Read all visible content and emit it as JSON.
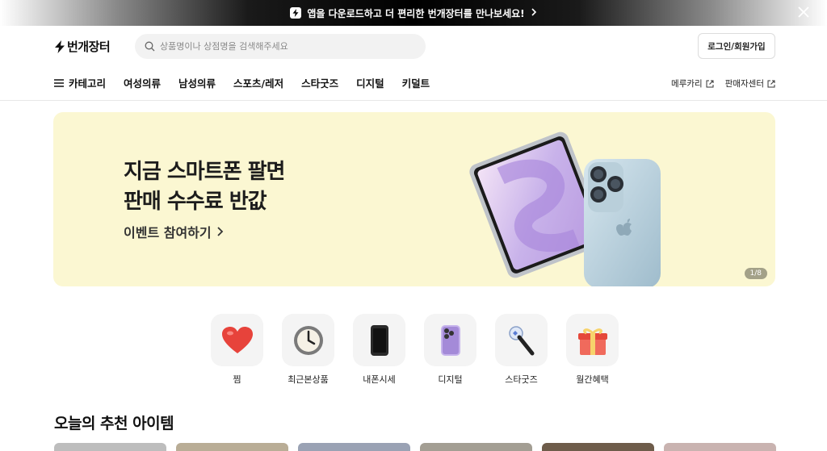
{
  "top_banner": {
    "text": "앱을 다운로드하고 더 편리한 번개장터를 만나보세요!",
    "chevron": "›"
  },
  "header": {
    "logo_text": "번개장터",
    "search_placeholder": "상품명이나 상점명을 검색해주세요",
    "login_label": "로그인/회원가입",
    "nav": [
      "카테고리",
      "여성의류",
      "남성의류",
      "스포츠/레저",
      "스타굿즈",
      "디지털",
      "키덜트"
    ],
    "ext_links": [
      "메루카리",
      "판매자센터"
    ]
  },
  "hero": {
    "title_line1": "지금 스마트폰 팔면",
    "title_line2": "판매 수수료 반값",
    "cta": "이벤트 참여하기",
    "pager": "1/8",
    "bg_color": "#fbf7d2"
  },
  "quick_menu": [
    {
      "label": "찜",
      "icon": "heart-icon"
    },
    {
      "label": "최근본상품",
      "icon": "clock-icon"
    },
    {
      "label": "내폰시세",
      "icon": "phone-icon"
    },
    {
      "label": "디지털",
      "icon": "smartphone-purple-icon"
    },
    {
      "label": "스타굿즈",
      "icon": "lightstick-icon"
    },
    {
      "label": "월간혜택",
      "icon": "gift-icon"
    }
  ],
  "recommend": {
    "title": "오늘의 추천 아이템"
  },
  "colors": {
    "accent": "#111111",
    "banner_bg": "#000000"
  }
}
